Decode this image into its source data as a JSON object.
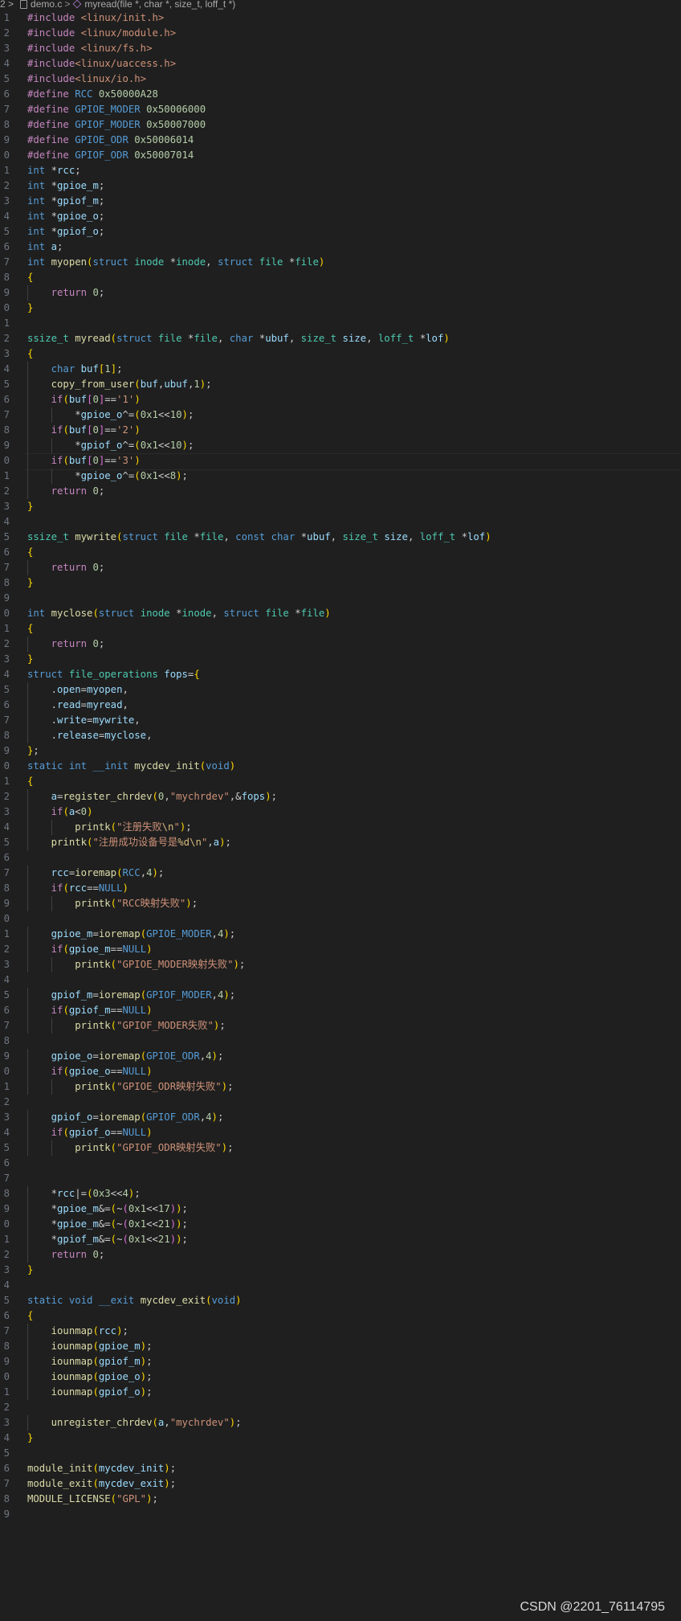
{
  "breadcrumb": {
    "folder": "2 >",
    "file": "demo.c",
    "symbol": "myread(file *, char *, size_t, loff_t *)"
  },
  "code_lines": [
    {
      "n": "1",
      "text": "#include <linux/init.h>"
    },
    {
      "n": "2",
      "text": "#include <linux/module.h>"
    },
    {
      "n": "3",
      "text": "#include <linux/fs.h>"
    },
    {
      "n": "4",
      "text": "#include<linux/uaccess.h>"
    },
    {
      "n": "5",
      "text": "#include<linux/io.h>"
    },
    {
      "n": "6",
      "text": "#define RCC 0x50000A28"
    },
    {
      "n": "7",
      "text": "#define GPIOE_MODER 0x50006000"
    },
    {
      "n": "8",
      "text": "#define GPIOF_MODER 0x50007000"
    },
    {
      "n": "9",
      "text": "#define GPIOE_ODR 0x50006014"
    },
    {
      "n": "0",
      "text": "#define GPIOF_ODR 0x50007014"
    },
    {
      "n": "1",
      "text": "int *rcc;"
    },
    {
      "n": "2",
      "text": "int *gpioe_m;"
    },
    {
      "n": "3",
      "text": "int *gpiof_m;"
    },
    {
      "n": "4",
      "text": "int *gpioe_o;"
    },
    {
      "n": "5",
      "text": "int *gpiof_o;"
    },
    {
      "n": "6",
      "text": "int a;"
    },
    {
      "n": "7",
      "text": "int myopen(struct inode *inode, struct file *file)"
    },
    {
      "n": "8",
      "text": "{"
    },
    {
      "n": "9",
      "text": "    return 0;"
    },
    {
      "n": "0",
      "text": "}"
    },
    {
      "n": "1",
      "text": ""
    },
    {
      "n": "2",
      "text": "ssize_t myread(struct file *file, char *ubuf, size_t size, loff_t *lof)"
    },
    {
      "n": "3",
      "text": "{"
    },
    {
      "n": "4",
      "text": "    char buf[1];"
    },
    {
      "n": "5",
      "text": "    copy_from_user(buf,ubuf,1);"
    },
    {
      "n": "6",
      "text": "    if(buf[0]=='1')"
    },
    {
      "n": "7",
      "text": "        *gpioe_o^=(0x1<<10);"
    },
    {
      "n": "8",
      "text": "    if(buf[0]=='2')"
    },
    {
      "n": "9",
      "text": "        *gpiof_o^=(0x1<<10);"
    },
    {
      "n": "0",
      "text": "    if(buf[0]=='3')"
    },
    {
      "n": "1",
      "text": "        *gpioe_o^=(0x1<<8);"
    },
    {
      "n": "2",
      "text": "    return 0;"
    },
    {
      "n": "3",
      "text": "}"
    },
    {
      "n": "4",
      "text": ""
    },
    {
      "n": "5",
      "text": "ssize_t mywrite(struct file *file, const char *ubuf, size_t size, loff_t *lof)"
    },
    {
      "n": "6",
      "text": "{"
    },
    {
      "n": "7",
      "text": "    return 0;"
    },
    {
      "n": "8",
      "text": "}"
    },
    {
      "n": "9",
      "text": ""
    },
    {
      "n": "0",
      "text": "int myclose(struct inode *inode, struct file *file)"
    },
    {
      "n": "1",
      "text": "{"
    },
    {
      "n": "2",
      "text": "    return 0;"
    },
    {
      "n": "3",
      "text": "}"
    },
    {
      "n": "4",
      "text": "struct file_operations fops={"
    },
    {
      "n": "5",
      "text": "    .open=myopen,"
    },
    {
      "n": "6",
      "text": "    .read=myread,"
    },
    {
      "n": "7",
      "text": "    .write=mywrite,"
    },
    {
      "n": "8",
      "text": "    .release=myclose,"
    },
    {
      "n": "9",
      "text": "};"
    },
    {
      "n": "0",
      "text": "static int __init mycdev_init(void)"
    },
    {
      "n": "1",
      "text": "{"
    },
    {
      "n": "2",
      "text": "    a=register_chrdev(0,\"mychrdev\",&fops);"
    },
    {
      "n": "3",
      "text": "    if(a<0)"
    },
    {
      "n": "4",
      "text": "        printk(\"注册失败\\n\");"
    },
    {
      "n": "5",
      "text": "    printk(\"注册成功设备号是%d\\n\",a);"
    },
    {
      "n": "6",
      "text": ""
    },
    {
      "n": "7",
      "text": "    rcc=ioremap(RCC,4);"
    },
    {
      "n": "8",
      "text": "    if(rcc==NULL)"
    },
    {
      "n": "9",
      "text": "        printk(\"RCC映射失败\");"
    },
    {
      "n": "0",
      "text": ""
    },
    {
      "n": "1",
      "text": "    gpioe_m=ioremap(GPIOE_MODER,4);"
    },
    {
      "n": "2",
      "text": "    if(gpioe_m==NULL)"
    },
    {
      "n": "3",
      "text": "        printk(\"GPIOE_MODER映射失败\");"
    },
    {
      "n": "4",
      "text": ""
    },
    {
      "n": "5",
      "text": "    gpiof_m=ioremap(GPIOF_MODER,4);"
    },
    {
      "n": "6",
      "text": "    if(gpiof_m==NULL)"
    },
    {
      "n": "7",
      "text": "        printk(\"GPIOF_MODER失败\");"
    },
    {
      "n": "8",
      "text": ""
    },
    {
      "n": "9",
      "text": "    gpioe_o=ioremap(GPIOE_ODR,4);"
    },
    {
      "n": "0",
      "text": "    if(gpioe_o==NULL)"
    },
    {
      "n": "1",
      "text": "        printk(\"GPIOE_ODR映射失败\");"
    },
    {
      "n": "2",
      "text": ""
    },
    {
      "n": "3",
      "text": "    gpiof_o=ioremap(GPIOF_ODR,4);"
    },
    {
      "n": "4",
      "text": "    if(gpiof_o==NULL)"
    },
    {
      "n": "5",
      "text": "        printk(\"GPIOF_ODR映射失败\");"
    },
    {
      "n": "6",
      "text": ""
    },
    {
      "n": "7",
      "text": ""
    },
    {
      "n": "8",
      "text": "    *rcc|=(0x3<<4);"
    },
    {
      "n": "9",
      "text": "    *gpioe_m&=(~(0x1<<17));"
    },
    {
      "n": "0",
      "text": "    *gpioe_m&=(~(0x1<<21));"
    },
    {
      "n": "1",
      "text": "    *gpiof_m&=(~(0x1<<21));"
    },
    {
      "n": "2",
      "text": "    return 0;"
    },
    {
      "n": "3",
      "text": "}"
    },
    {
      "n": "4",
      "text": ""
    },
    {
      "n": "5",
      "text": "static void __exit mycdev_exit(void)"
    },
    {
      "n": "6",
      "text": "{"
    },
    {
      "n": "7",
      "text": "    iounmap(rcc);"
    },
    {
      "n": "8",
      "text": "    iounmap(gpioe_m);"
    },
    {
      "n": "9",
      "text": "    iounmap(gpiof_m);"
    },
    {
      "n": "0",
      "text": "    iounmap(gpioe_o);"
    },
    {
      "n": "1",
      "text": "    iounmap(gpiof_o);"
    },
    {
      "n": "2",
      "text": ""
    },
    {
      "n": "3",
      "text": "    unregister_chrdev(a,\"mychrdev\");"
    },
    {
      "n": "4",
      "text": "}"
    },
    {
      "n": "5",
      "text": ""
    },
    {
      "n": "6",
      "text": "module_init(mycdev_init);"
    },
    {
      "n": "7",
      "text": "module_exit(mycdev_exit);"
    },
    {
      "n": "8",
      "text": "MODULE_LICENSE(\"GPL\");"
    },
    {
      "n": "9",
      "text": ""
    }
  ],
  "watermark": "CSDN @2201_76114795",
  "theme": {
    "background": "#1f1f1f",
    "keyword": "#569cd6",
    "type": "#4ec9b0",
    "function": "#dcdcaa",
    "string": "#ce9178",
    "number": "#b5cea8",
    "control": "#c586c0",
    "variable": "#9cdcfe"
  }
}
